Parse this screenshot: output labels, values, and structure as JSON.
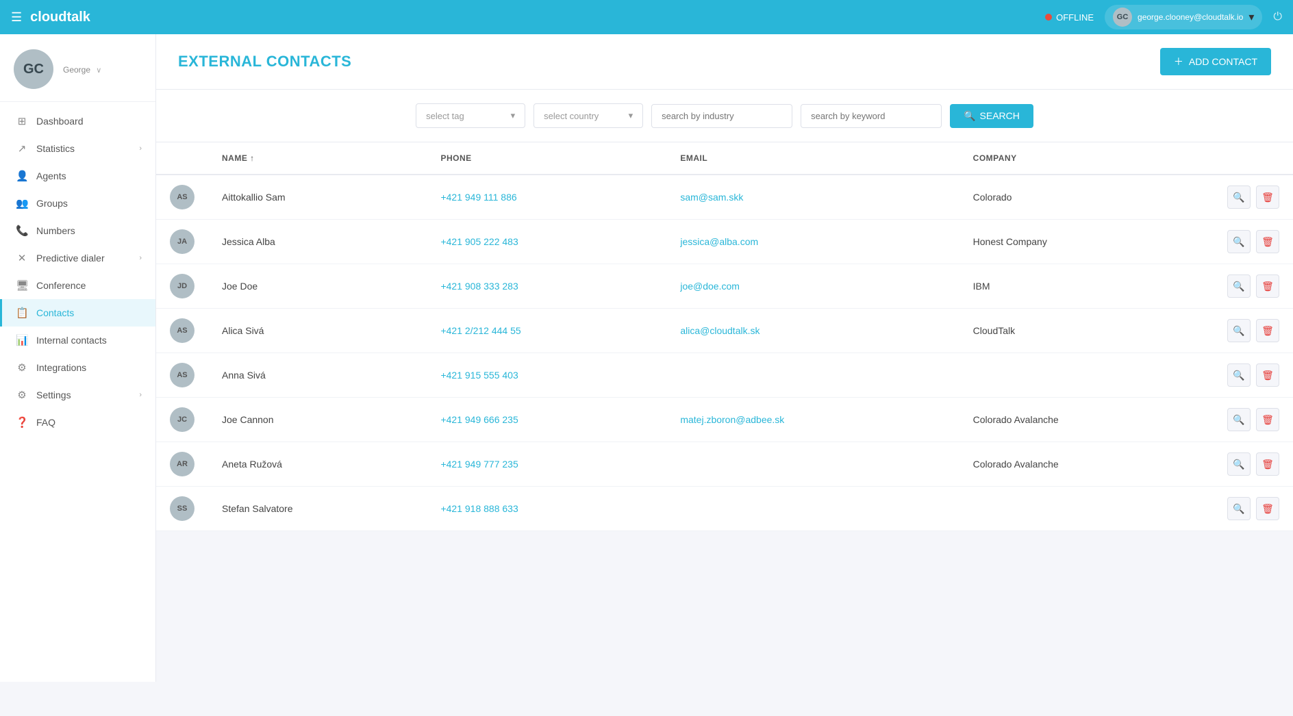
{
  "topnav": {
    "hamburger_icon": "☰",
    "logo": "cloudtalk",
    "status": "OFFLINE",
    "user_initials": "GC",
    "user_email": "george.clooney@cloudtalk.io",
    "chevron_icon": "▾",
    "power_icon": "⏻"
  },
  "sidebar": {
    "avatar_initials": "GC",
    "username": "George",
    "username_arrow": "∨",
    "nav_items": [
      {
        "id": "dashboard",
        "icon": "⊞",
        "label": "Dashboard",
        "has_arrow": false
      },
      {
        "id": "statistics",
        "icon": "↗",
        "label": "Statistics",
        "has_arrow": true
      },
      {
        "id": "agents",
        "icon": "👤",
        "label": "Agents",
        "has_arrow": false
      },
      {
        "id": "groups",
        "icon": "👥",
        "label": "Groups",
        "has_arrow": false
      },
      {
        "id": "numbers",
        "icon": "📞",
        "label": "Numbers",
        "has_arrow": false
      },
      {
        "id": "predictive-dialer",
        "icon": "✕",
        "label": "Predictive dialer",
        "has_arrow": true
      },
      {
        "id": "conference",
        "icon": "🖥",
        "label": "Conference",
        "has_arrow": false
      },
      {
        "id": "contacts",
        "icon": "📋",
        "label": "Contacts",
        "has_arrow": false,
        "active": true
      },
      {
        "id": "internal-contacts",
        "icon": "📊",
        "label": "Internal contacts",
        "has_arrow": false
      },
      {
        "id": "integrations",
        "icon": "⚙",
        "label": "Integrations",
        "has_arrow": false
      },
      {
        "id": "settings",
        "icon": "⚙",
        "label": "Settings",
        "has_arrow": true
      },
      {
        "id": "faq",
        "icon": "❓",
        "label": "FAQ",
        "has_arrow": false
      }
    ]
  },
  "header": {
    "title": "EXTERNAL CONTACTS",
    "add_button_label": "ADD CONTACT",
    "add_icon": "+"
  },
  "filters": {
    "select_tag_placeholder": "select tag",
    "select_tag_arrow": "▾",
    "select_country_placeholder": "select country",
    "select_country_arrow": "▾",
    "search_industry_placeholder": "search by industry",
    "search_keyword_placeholder": "search by keyword",
    "search_button_label": "SEARCH",
    "search_icon": "🔍"
  },
  "table": {
    "columns": [
      {
        "id": "avatar",
        "label": ""
      },
      {
        "id": "name",
        "label": "NAME ↑",
        "sortable": true
      },
      {
        "id": "phone",
        "label": "PHONE"
      },
      {
        "id": "email",
        "label": "EMAIL"
      },
      {
        "id": "company",
        "label": "COMPANY"
      },
      {
        "id": "actions",
        "label": ""
      }
    ],
    "rows": [
      {
        "initials": "AS",
        "name": "Aittokallio Sam",
        "phone": "+421 949 111 886",
        "email": "sam@sam.skk",
        "company": "Colorado"
      },
      {
        "initials": "JA",
        "name": "Jessica Alba",
        "phone": "+421 905 222 483",
        "email": "jessica@alba.com",
        "company": "Honest Company"
      },
      {
        "initials": "JD",
        "name": "Joe Doe",
        "phone": "+421 908 333 283",
        "email": "joe@doe.com",
        "company": "IBM"
      },
      {
        "initials": "AS",
        "name": "Alica Sivá",
        "phone": "+421 2/212 444 55",
        "email": "alica@cloudtalk.sk",
        "company": "CloudTalk"
      },
      {
        "initials": "AS",
        "name": "Anna Sivá",
        "phone": "+421 915 555 403",
        "email": "",
        "company": ""
      },
      {
        "initials": "JC",
        "name": "Joe Cannon",
        "phone": "+421 949 666 235",
        "email": "matej.zboron@adbee.sk",
        "company": "Colorado Avalanche"
      },
      {
        "initials": "AR",
        "name": "Aneta Ružová",
        "phone": "+421 949 777 235",
        "email": "",
        "company": "Colorado Avalanche"
      },
      {
        "initials": "SS",
        "name": "Stefan Salvatore",
        "phone": "+421 918 888 633",
        "email": "",
        "company": ""
      }
    ]
  }
}
